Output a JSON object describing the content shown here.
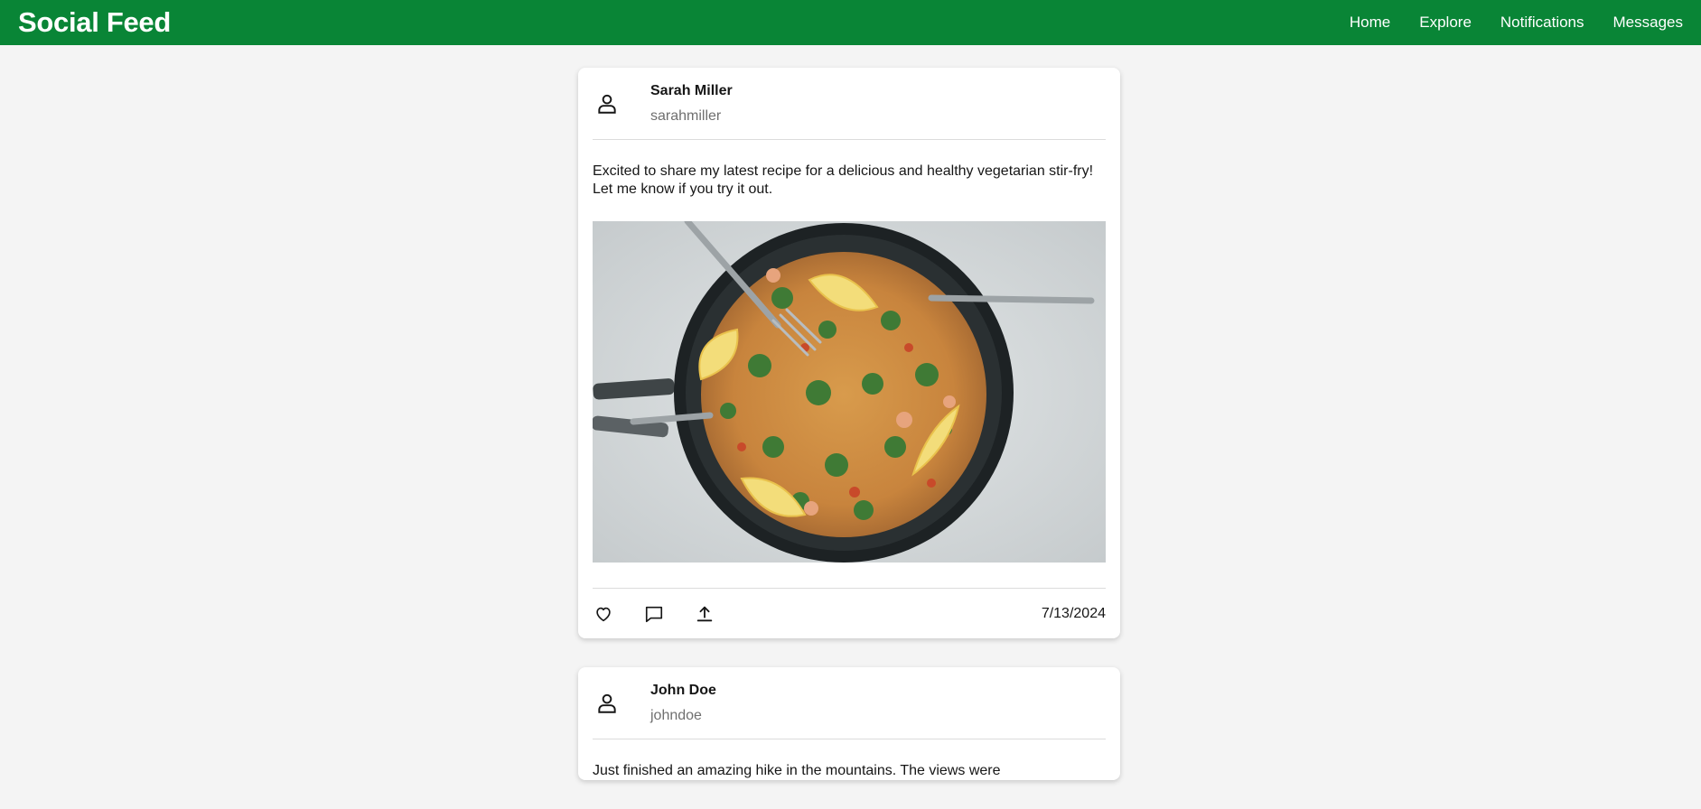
{
  "app": {
    "title": "Social Feed",
    "brand_color": "#098536"
  },
  "nav": {
    "items": [
      {
        "label": "Home"
      },
      {
        "label": "Explore"
      },
      {
        "label": "Notifications"
      },
      {
        "label": "Messages"
      }
    ]
  },
  "posts": [
    {
      "author": "Sarah Miller",
      "handle": "sarahmiller",
      "text": "Excited to share my latest recipe for a delicious and healthy vegetarian stir-fry! Let me know if you try it out.",
      "image_icon": "food-photo",
      "date": "7/13/2024",
      "actions": [
        "heart-icon",
        "comment-icon",
        "share-icon"
      ]
    },
    {
      "author": "John Doe",
      "handle": "johndoe",
      "text": "Just finished an amazing hike in the mountains. The views were"
    }
  ]
}
